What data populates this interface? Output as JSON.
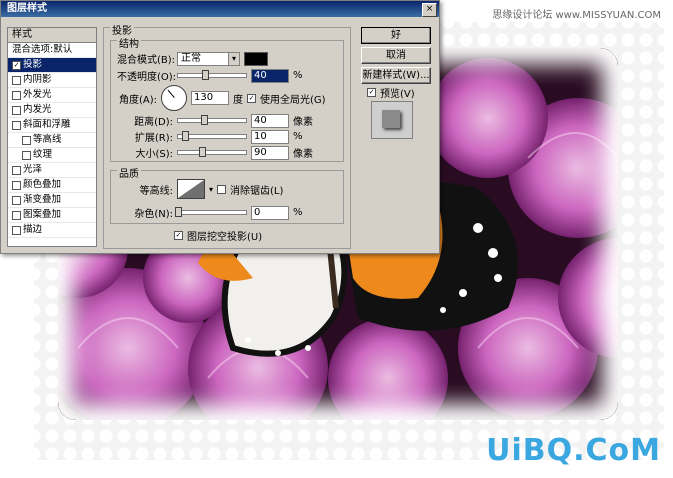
{
  "watermark": "思缘设计论坛 www.MISSYUAN.COM",
  "brand": "UiBQ.CoM",
  "dialog": {
    "title": "图层样式",
    "close_label": "×",
    "list_header": "样式",
    "list_items": [
      {
        "label": "混合选项:默认",
        "checkbox": false,
        "checked": false,
        "selected": false,
        "indent": false
      },
      {
        "label": "投影",
        "checkbox": true,
        "checked": true,
        "selected": true,
        "indent": false
      },
      {
        "label": "内阴影",
        "checkbox": true,
        "checked": false,
        "selected": false,
        "indent": false
      },
      {
        "label": "外发光",
        "checkbox": true,
        "checked": false,
        "selected": false,
        "indent": false
      },
      {
        "label": "内发光",
        "checkbox": true,
        "checked": false,
        "selected": false,
        "indent": false
      },
      {
        "label": "斜面和浮雕",
        "checkbox": true,
        "checked": false,
        "selected": false,
        "indent": false
      },
      {
        "label": "等高线",
        "checkbox": true,
        "checked": false,
        "selected": false,
        "indent": true
      },
      {
        "label": "纹理",
        "checkbox": true,
        "checked": false,
        "selected": false,
        "indent": true
      },
      {
        "label": "光泽",
        "checkbox": true,
        "checked": false,
        "selected": false,
        "indent": false
      },
      {
        "label": "颜色叠加",
        "checkbox": true,
        "checked": false,
        "selected": false,
        "indent": false
      },
      {
        "label": "渐变叠加",
        "checkbox": true,
        "checked": false,
        "selected": false,
        "indent": false
      },
      {
        "label": "图案叠加",
        "checkbox": true,
        "checked": false,
        "selected": false,
        "indent": false
      },
      {
        "label": "描边",
        "checkbox": true,
        "checked": false,
        "selected": false,
        "indent": false
      }
    ],
    "section_title": "投影",
    "structure": {
      "title": "结构",
      "blend_mode_label": "混合模式(B):",
      "blend_mode_value": "正常",
      "shadow_color": "#000000",
      "opacity_label": "不透明度(O):",
      "opacity_value": "40",
      "opacity_unit": "%",
      "opacity_fraction": 0.4,
      "angle_label": "角度(A):",
      "angle_value": "130",
      "angle_unit": "度",
      "global_light_label": "使用全局光(G)",
      "global_light_checked": true,
      "distance_label": "距离(D):",
      "distance_value": "40",
      "distance_unit": "像素",
      "spread_label": "扩展(R):",
      "spread_value": "10",
      "spread_unit": "%",
      "size_label": "大小(S):",
      "size_value": "90",
      "size_unit": "像素"
    },
    "quality": {
      "title": "品质",
      "contour_label": "等高线:",
      "antialias_label": "消除锯齿(L)",
      "antialias_checked": false,
      "noise_label": "杂色(N):",
      "noise_value": "0",
      "noise_unit": "%"
    },
    "knockout_label": "图层挖空投影(U)",
    "knockout_checked": true,
    "buttons": {
      "ok": "好",
      "cancel": "取消",
      "new_style": "新建样式(W)...",
      "preview_label": "预览(V)",
      "preview_checked": true
    }
  }
}
